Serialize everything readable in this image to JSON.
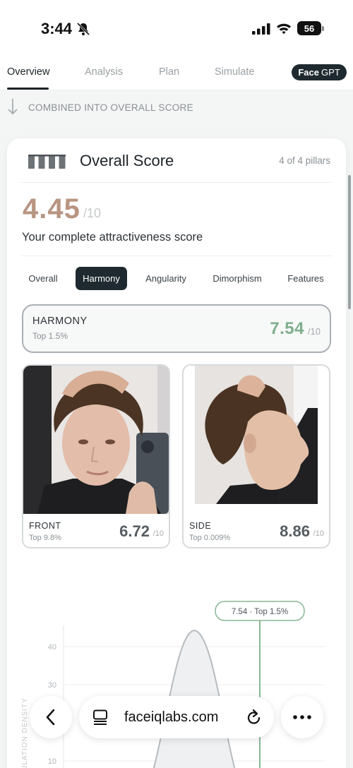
{
  "status": {
    "time": "3:44",
    "battery": "56"
  },
  "tabs": [
    {
      "label": "Overview"
    },
    {
      "label": "Analysis"
    },
    {
      "label": "Plan"
    },
    {
      "label": "Simulate"
    }
  ],
  "face_gpt": {
    "bold": "Face",
    "rest": "GPT"
  },
  "combined_text": "COMBINED INTO OVERALL SCORE",
  "card": {
    "title": "Overall Score",
    "pillars": "4 of 4 pillars",
    "score": "4.45",
    "score_max": "/10",
    "subtitle": "Your complete attractiveness score"
  },
  "pills": [
    {
      "label": "Overall"
    },
    {
      "label": "Harmony"
    },
    {
      "label": "Angularity"
    },
    {
      "label": "Dimorphism"
    },
    {
      "label": "Features"
    }
  ],
  "harmony": {
    "label": "HARMONY",
    "sub": "Top 1.5%",
    "score": "7.54",
    "max": "/10"
  },
  "photos": [
    {
      "label": "FRONT",
      "sub": "Top 9.8%",
      "score": "6.72",
      "max": "/10"
    },
    {
      "label": "SIDE",
      "sub": "Top 0.009%",
      "score": "8.86",
      "max": "/10"
    }
  ],
  "chart_data": {
    "type": "area",
    "ylabel": "POPULATION DENSITY",
    "y_ticks": [
      40,
      30,
      10
    ],
    "marker_label": "7.54 · Top 1.5%",
    "marker_value": 7.54
  },
  "browser": {
    "url": "faceiqlabs.com"
  }
}
